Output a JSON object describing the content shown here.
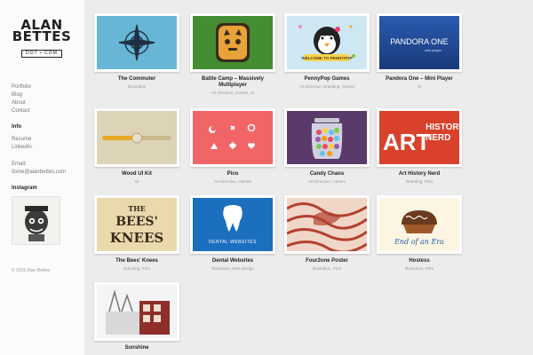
{
  "logo": {
    "line1": "ALAN",
    "line2": "BETTES",
    "badge": "DOT • COM"
  },
  "nav": [
    "Portfolio",
    "Blog",
    "About",
    "Contact"
  ],
  "info": {
    "heading": "Info",
    "links": [
      "Resume",
      "LinkedIn"
    ],
    "email_label": "Email:",
    "email": "itsme@alanbettes.com"
  },
  "instagram": {
    "heading": "Instagram"
  },
  "copyright": "© 2015 Alan Bettes",
  "projects": [
    {
      "title": "The Commuter",
      "sub": "Illustration"
    },
    {
      "title": "Battle Camp – Massively Multiplayer",
      "sub": "Art Direction, Games, UI"
    },
    {
      "title": "PennyPop Games",
      "sub": "Art Direction, Branding, Games"
    },
    {
      "title": "Pandora One – Mini Player",
      "sub": "UI"
    },
    {
      "title": "Wood UI Kit",
      "sub": "UI"
    },
    {
      "title": "Pico",
      "sub": "Art Direction, Games"
    },
    {
      "title": "Candy Chaos",
      "sub": "Art Direction, Games"
    },
    {
      "title": "Art History Nerd",
      "sub": "Branding, Print"
    },
    {
      "title": "The Bees' Knees",
      "sub": "Branding, Print"
    },
    {
      "title": "Dental Websites",
      "sub": "Illustration, Web Design"
    },
    {
      "title": "Four2one Poster",
      "sub": "Illustration, Print"
    },
    {
      "title": "Hostess",
      "sub": "Illustration, Print"
    },
    {
      "title": "Sunshine",
      "sub": ""
    }
  ],
  "thumb_text": {
    "pandora": "PANDORA ONE",
    "pandora_sub": "mini player",
    "penny_banner": "WELCOME TO PENNYPOP",
    "art1": "ART",
    "art2": "HISTORY",
    "art3": "NERD",
    "bees1": "THE",
    "bees2": "BEES'",
    "bees3": "KNEES",
    "dental": "DENTAL WEBSITES",
    "hostess": "End of an Era"
  },
  "colors": {
    "commuter_bg": "#67b6d5",
    "battle_bg": "#4c9a38",
    "penny_bg": "#cfe7f3",
    "pandora_bg": "#1e4a9a",
    "wood_bg": "#ddd3b6",
    "pico_bg": "#f26566",
    "candy_bg": "#5a3a6a",
    "art_bg": "#d9412b",
    "bees_bg": "#ead9ad",
    "dental_bg": "#1c6fbf",
    "poster_bg": "#f0d6c6",
    "hostess_bg": "#fbf5e2"
  }
}
